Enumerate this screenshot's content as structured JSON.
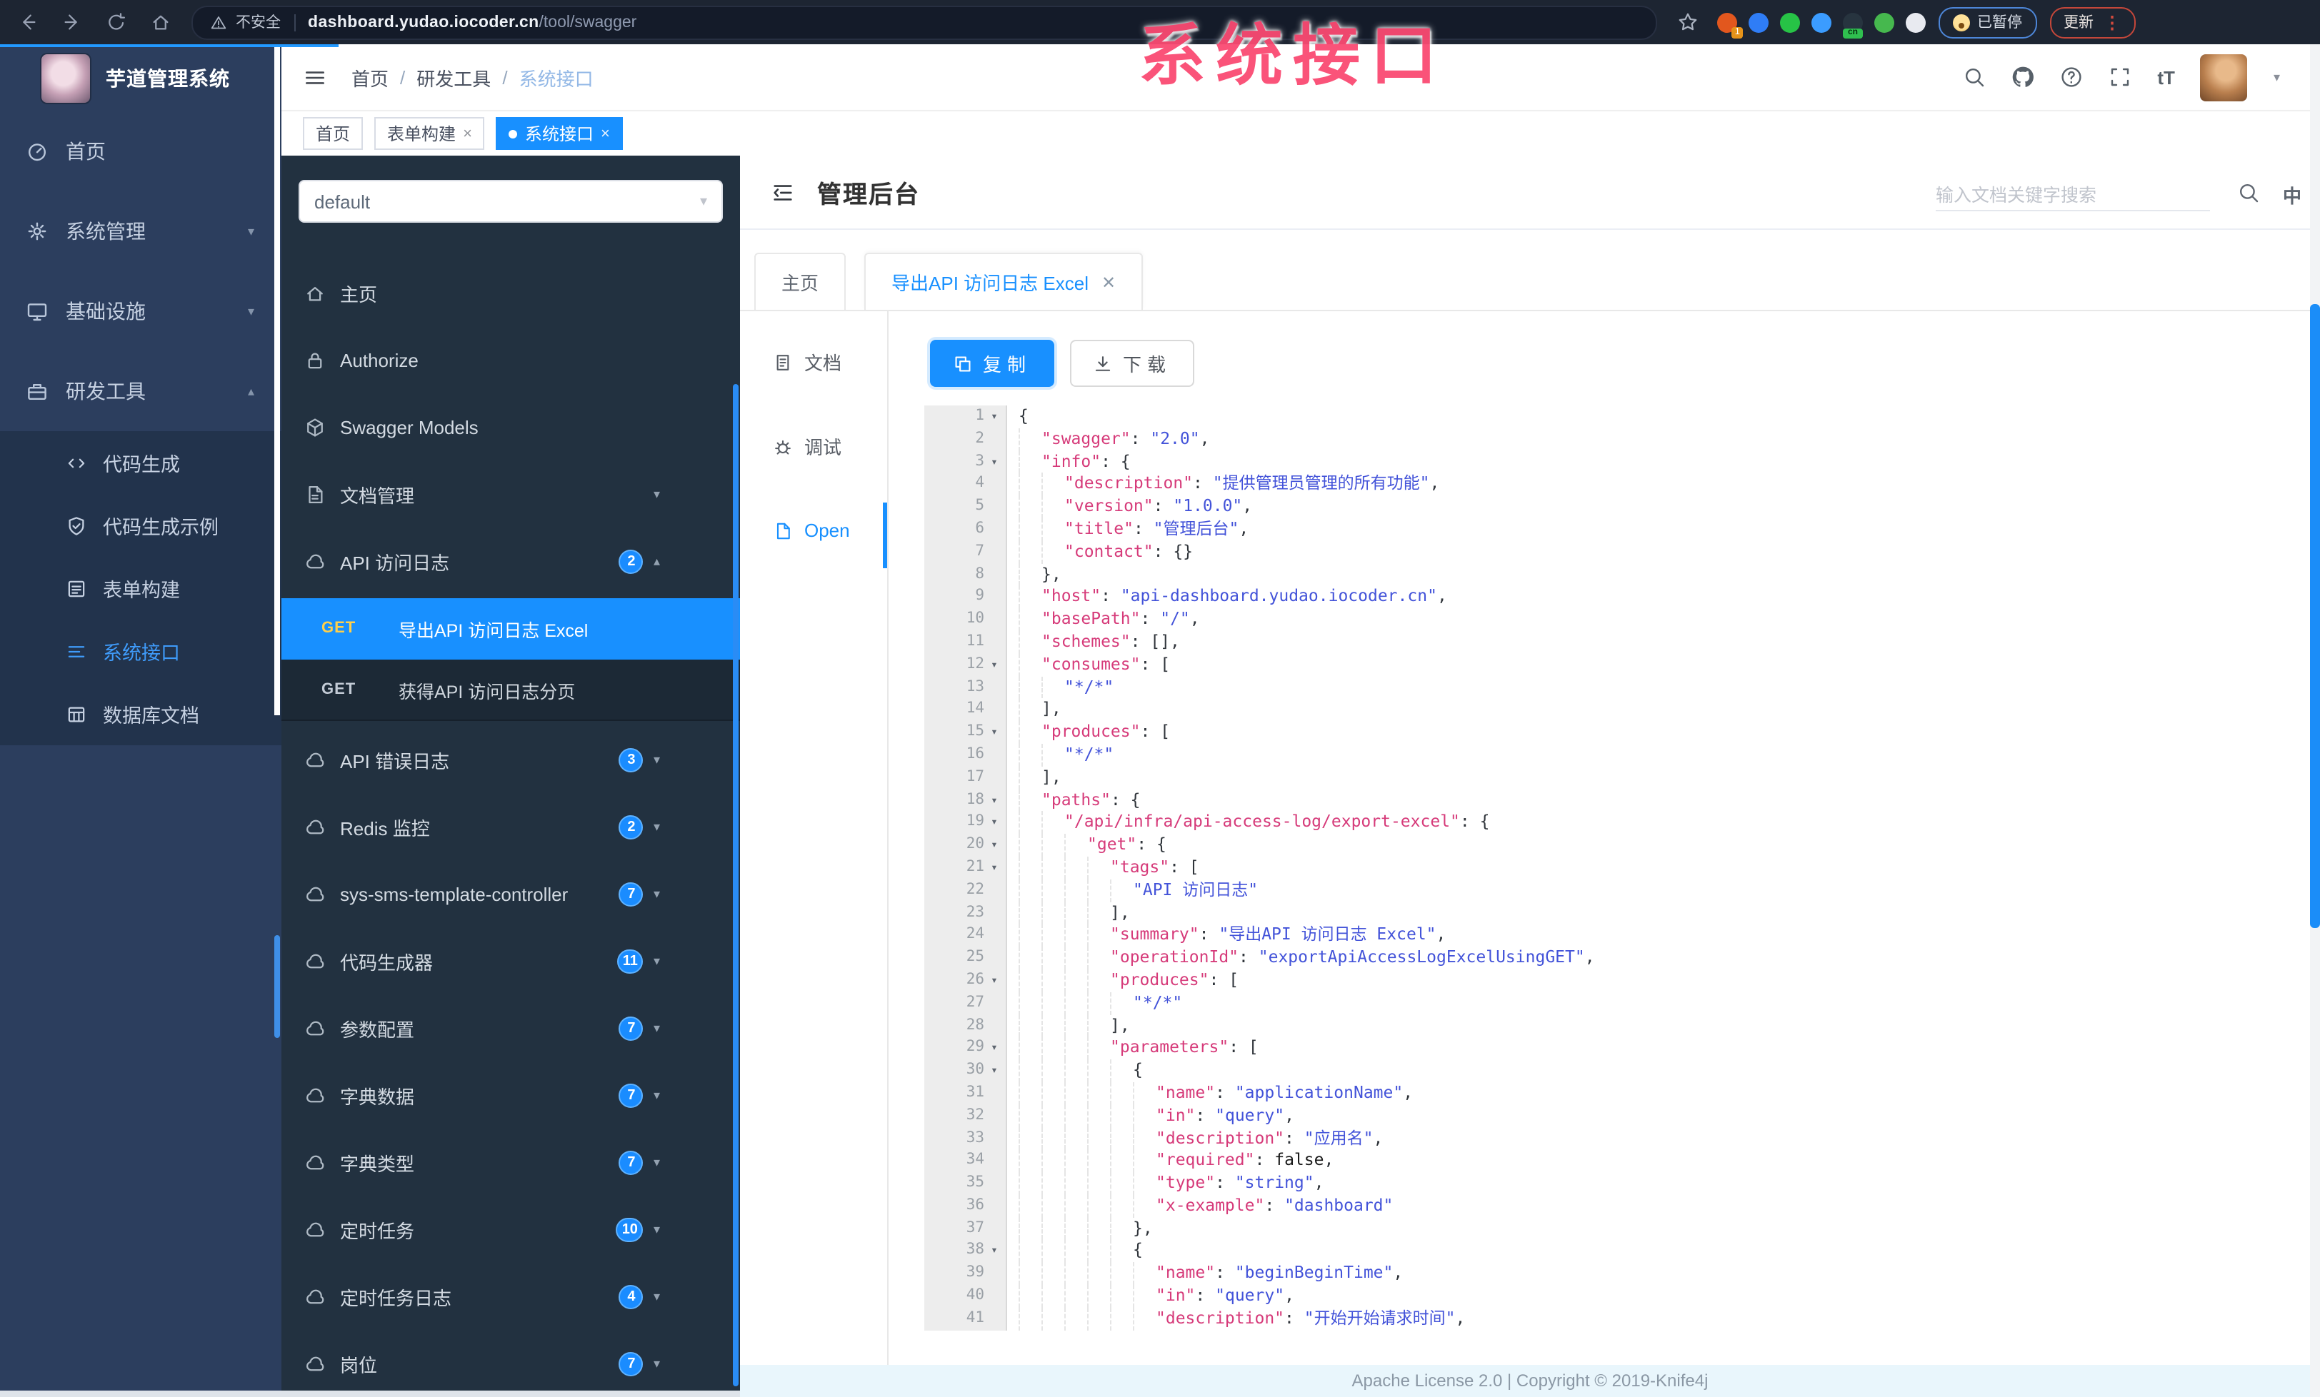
{
  "watermark": {
    "text": "系统接口"
  },
  "browser": {
    "security_label": "不安全",
    "url_host": "dashboard.yudao.iocoder.cn",
    "url_path": "/tool/swagger",
    "paused_chip": "已暂停",
    "update_chip": "更新",
    "extensions": [
      {
        "name": "ext-orange-icon",
        "color": "#e2571e",
        "badge": "1"
      },
      {
        "name": "ext-pin-icon",
        "color": "#2f7df6"
      },
      {
        "name": "ext-check-icon",
        "color": "#27c346"
      },
      {
        "name": "ext-grid-icon",
        "color": "#3b9cff"
      },
      {
        "name": "ext-cn-icon",
        "color": "#27343f",
        "label": "cn"
      },
      {
        "name": "ext-alien-icon",
        "color": "#46b84e"
      },
      {
        "name": "ext-ghost-icon",
        "color": "#e8eaf0"
      }
    ]
  },
  "app_sidebar": {
    "logo_title": "芋道管理系统",
    "items": [
      {
        "label": "首页",
        "icon": "dashboard-icon"
      },
      {
        "label": "系统管理",
        "icon": "gear-icon",
        "chevron": "down"
      },
      {
        "label": "基础设施",
        "icon": "monitor-icon",
        "chevron": "down"
      },
      {
        "label": "研发工具",
        "icon": "toolbox-icon",
        "chevron": "up"
      }
    ],
    "subitems": [
      {
        "label": "代码生成",
        "icon": "code-icon"
      },
      {
        "label": "代码生成示例",
        "icon": "shield-check-icon"
      },
      {
        "label": "表单构建",
        "icon": "form-icon"
      },
      {
        "label": "系统接口",
        "icon": "list-icon",
        "active": true
      },
      {
        "label": "数据库文档",
        "icon": "database-icon"
      }
    ]
  },
  "topbar": {
    "breadcrumb": [
      "首页",
      "研发工具",
      "系统接口"
    ]
  },
  "tagbar": {
    "tags": [
      {
        "label": "首页"
      },
      {
        "label": "表单构建",
        "closable": true
      },
      {
        "label": "系统接口",
        "closable": true,
        "active": true
      }
    ]
  },
  "swagger_sidebar": {
    "group_value": "default",
    "items": [
      {
        "type": "item",
        "label": "主页",
        "icon": "home-icon"
      },
      {
        "type": "item",
        "label": "Authorize",
        "icon": "lock-icon"
      },
      {
        "type": "item",
        "label": "Swagger Models",
        "icon": "cube-icon"
      },
      {
        "type": "item",
        "label": "文档管理",
        "icon": "document-icon",
        "chevron": "down"
      },
      {
        "type": "item",
        "label": "API 访问日志",
        "icon": "cloud-icon",
        "badge": "2",
        "chevron": "up"
      },
      {
        "type": "get",
        "method": "GET",
        "label": "导出API 访问日志 Excel",
        "active": true
      },
      {
        "type": "get",
        "method": "GET",
        "label": "获得API 访问日志分页"
      },
      {
        "type": "item",
        "label": "API 错误日志",
        "icon": "cloud-icon",
        "badge": "3",
        "chevron": "down"
      },
      {
        "type": "item",
        "label": "Redis 监控",
        "icon": "cloud-icon",
        "badge": "2",
        "chevron": "down"
      },
      {
        "type": "item",
        "label": "sys-sms-template-controller",
        "icon": "cloud-icon",
        "badge": "7",
        "chevron": "down"
      },
      {
        "type": "item",
        "label": "代码生成器",
        "icon": "cloud-icon",
        "badge": "11",
        "chevron": "down"
      },
      {
        "type": "item",
        "label": "参数配置",
        "icon": "cloud-icon",
        "badge": "7",
        "chevron": "down"
      },
      {
        "type": "item",
        "label": "字典数据",
        "icon": "cloud-icon",
        "badge": "7",
        "chevron": "down"
      },
      {
        "type": "item",
        "label": "字典类型",
        "icon": "cloud-icon",
        "badge": "7",
        "chevron": "down"
      },
      {
        "type": "item",
        "label": "定时任务",
        "icon": "cloud-icon",
        "badge": "10",
        "chevron": "down"
      },
      {
        "type": "item",
        "label": "定时任务日志",
        "icon": "cloud-icon",
        "badge": "4",
        "chevron": "down"
      },
      {
        "type": "item",
        "label": "岗位",
        "icon": "cloud-icon",
        "badge": "7",
        "chevron": "down"
      }
    ]
  },
  "doc": {
    "title": "管理后台",
    "search_placeholder": "输入文档关键字搜索",
    "lang_icon_label": "中",
    "tabs": [
      {
        "label": "主页"
      },
      {
        "label": "导出API 访问日志 Excel",
        "closable": true,
        "active": true
      }
    ],
    "side_tabs": [
      {
        "label": "文档",
        "icon": "doc-text-icon"
      },
      {
        "label": "调试",
        "icon": "debug-icon"
      },
      {
        "label": "Open",
        "icon": "file-icon",
        "active": true
      }
    ],
    "copy_label": "复制",
    "download_label": "下载",
    "footer": "Apache License 2.0 | Copyright © 2019-Knife4j"
  },
  "code": {
    "lines": [
      {
        "n": 1,
        "f": 1,
        "i": 0,
        "t": [
          [
            "p",
            "{"
          ]
        ]
      },
      {
        "n": 2,
        "i": 1,
        "t": [
          [
            "k",
            "\"swagger\""
          ],
          [
            "p",
            ": "
          ],
          [
            "s",
            "\"2.0\""
          ],
          [
            "p",
            ","
          ]
        ]
      },
      {
        "n": 3,
        "f": 1,
        "i": 1,
        "t": [
          [
            "k",
            "\"info\""
          ],
          [
            "p",
            ": {"
          ]
        ]
      },
      {
        "n": 4,
        "i": 2,
        "t": [
          [
            "k",
            "\"description\""
          ],
          [
            "p",
            ": "
          ],
          [
            "s",
            "\"提供管理员管理的所有功能\""
          ],
          [
            "p",
            ","
          ]
        ]
      },
      {
        "n": 5,
        "i": 2,
        "t": [
          [
            "k",
            "\"version\""
          ],
          [
            "p",
            ": "
          ],
          [
            "s",
            "\"1.0.0\""
          ],
          [
            "p",
            ","
          ]
        ]
      },
      {
        "n": 6,
        "i": 2,
        "t": [
          [
            "k",
            "\"title\""
          ],
          [
            "p",
            ": "
          ],
          [
            "s",
            "\"管理后台\""
          ],
          [
            "p",
            ","
          ]
        ]
      },
      {
        "n": 7,
        "i": 2,
        "t": [
          [
            "k",
            "\"contact\""
          ],
          [
            "p",
            ": {}"
          ]
        ]
      },
      {
        "n": 8,
        "i": 1,
        "t": [
          [
            "p",
            "},"
          ]
        ]
      },
      {
        "n": 9,
        "i": 1,
        "t": [
          [
            "k",
            "\"host\""
          ],
          [
            "p",
            ": "
          ],
          [
            "s",
            "\"api-dashboard.yudao.iocoder.cn\""
          ],
          [
            "p",
            ","
          ]
        ]
      },
      {
        "n": 10,
        "i": 1,
        "t": [
          [
            "k",
            "\"basePath\""
          ],
          [
            "p",
            ": "
          ],
          [
            "s",
            "\"/\""
          ],
          [
            "p",
            ","
          ]
        ]
      },
      {
        "n": 11,
        "i": 1,
        "t": [
          [
            "k",
            "\"schemes\""
          ],
          [
            "p",
            ": [],"
          ]
        ]
      },
      {
        "n": 12,
        "f": 1,
        "i": 1,
        "t": [
          [
            "k",
            "\"consumes\""
          ],
          [
            "p",
            ": ["
          ]
        ]
      },
      {
        "n": 13,
        "i": 2,
        "t": [
          [
            "s",
            "\"*/*\""
          ]
        ]
      },
      {
        "n": 14,
        "i": 1,
        "t": [
          [
            "p",
            "],"
          ]
        ]
      },
      {
        "n": 15,
        "f": 1,
        "i": 1,
        "t": [
          [
            "k",
            "\"produces\""
          ],
          [
            "p",
            ": ["
          ]
        ]
      },
      {
        "n": 16,
        "i": 2,
        "t": [
          [
            "s",
            "\"*/*\""
          ]
        ]
      },
      {
        "n": 17,
        "i": 1,
        "t": [
          [
            "p",
            "],"
          ]
        ]
      },
      {
        "n": 18,
        "f": 1,
        "i": 1,
        "t": [
          [
            "k",
            "\"paths\""
          ],
          [
            "p",
            ": {"
          ]
        ]
      },
      {
        "n": 19,
        "f": 1,
        "i": 2,
        "t": [
          [
            "k",
            "\"/api/infra/api-access-log/export-excel\""
          ],
          [
            "p",
            ": {"
          ]
        ]
      },
      {
        "n": 20,
        "f": 1,
        "i": 3,
        "t": [
          [
            "k",
            "\"get\""
          ],
          [
            "p",
            ": {"
          ]
        ]
      },
      {
        "n": 21,
        "f": 1,
        "i": 4,
        "t": [
          [
            "k",
            "\"tags\""
          ],
          [
            "p",
            ": ["
          ]
        ]
      },
      {
        "n": 22,
        "i": 5,
        "t": [
          [
            "s",
            "\"API 访问日志\""
          ]
        ]
      },
      {
        "n": 23,
        "i": 4,
        "t": [
          [
            "p",
            "],"
          ]
        ]
      },
      {
        "n": 24,
        "i": 4,
        "t": [
          [
            "k",
            "\"summary\""
          ],
          [
            "p",
            ": "
          ],
          [
            "s",
            "\"导出API 访问日志 Excel\""
          ],
          [
            "p",
            ","
          ]
        ]
      },
      {
        "n": 25,
        "i": 4,
        "t": [
          [
            "k",
            "\"operationId\""
          ],
          [
            "p",
            ": "
          ],
          [
            "s",
            "\"exportApiAccessLogExcelUsingGET\""
          ],
          [
            "p",
            ","
          ]
        ]
      },
      {
        "n": 26,
        "f": 1,
        "i": 4,
        "t": [
          [
            "k",
            "\"produces\""
          ],
          [
            "p",
            ": ["
          ]
        ]
      },
      {
        "n": 27,
        "i": 5,
        "t": [
          [
            "s",
            "\"*/*\""
          ]
        ]
      },
      {
        "n": 28,
        "i": 4,
        "t": [
          [
            "p",
            "],"
          ]
        ]
      },
      {
        "n": 29,
        "f": 1,
        "i": 4,
        "t": [
          [
            "k",
            "\"parameters\""
          ],
          [
            "p",
            ": ["
          ]
        ]
      },
      {
        "n": 30,
        "f": 1,
        "i": 5,
        "t": [
          [
            "p",
            "{"
          ]
        ]
      },
      {
        "n": 31,
        "i": 6,
        "t": [
          [
            "k",
            "\"name\""
          ],
          [
            "p",
            ": "
          ],
          [
            "s",
            "\"applicationName\""
          ],
          [
            "p",
            ","
          ]
        ]
      },
      {
        "n": 32,
        "i": 6,
        "t": [
          [
            "k",
            "\"in\""
          ],
          [
            "p",
            ": "
          ],
          [
            "s",
            "\"query\""
          ],
          [
            "p",
            ","
          ]
        ]
      },
      {
        "n": 33,
        "i": 6,
        "t": [
          [
            "k",
            "\"description\""
          ],
          [
            "p",
            ": "
          ],
          [
            "s",
            "\"应用名\""
          ],
          [
            "p",
            ","
          ]
        ]
      },
      {
        "n": 34,
        "i": 6,
        "t": [
          [
            "k",
            "\"required\""
          ],
          [
            "p",
            ": "
          ],
          [
            "b",
            "false"
          ],
          [
            "p",
            ","
          ]
        ]
      },
      {
        "n": 35,
        "i": 6,
        "t": [
          [
            "k",
            "\"type\""
          ],
          [
            "p",
            ": "
          ],
          [
            "s",
            "\"string\""
          ],
          [
            "p",
            ","
          ]
        ]
      },
      {
        "n": 36,
        "i": 6,
        "t": [
          [
            "k",
            "\"x-example\""
          ],
          [
            "p",
            ": "
          ],
          [
            "s",
            "\"dashboard\""
          ]
        ]
      },
      {
        "n": 37,
        "i": 5,
        "t": [
          [
            "p",
            "},"
          ]
        ]
      },
      {
        "n": 38,
        "f": 1,
        "i": 5,
        "t": [
          [
            "p",
            "{"
          ]
        ]
      },
      {
        "n": 39,
        "i": 6,
        "t": [
          [
            "k",
            "\"name\""
          ],
          [
            "p",
            ": "
          ],
          [
            "s",
            "\"beginBeginTime\""
          ],
          [
            "p",
            ","
          ]
        ]
      },
      {
        "n": 40,
        "i": 6,
        "t": [
          [
            "k",
            "\"in\""
          ],
          [
            "p",
            ": "
          ],
          [
            "s",
            "\"query\""
          ],
          [
            "p",
            ","
          ]
        ]
      },
      {
        "n": 41,
        "i": 6,
        "t": [
          [
            "k",
            "\"description\""
          ],
          [
            "p",
            ": "
          ],
          [
            "s",
            "\"开始开始请求时间\""
          ],
          [
            "p",
            ","
          ]
        ]
      }
    ]
  }
}
